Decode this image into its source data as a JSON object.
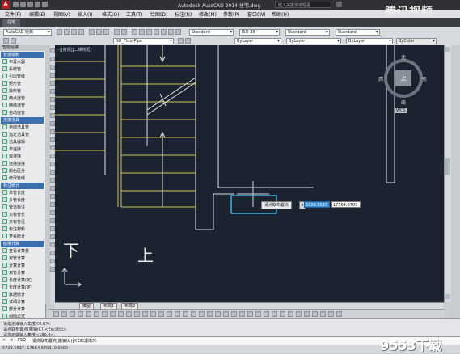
{
  "titlebar": {
    "app_letter": "A",
    "title": "Autodesk AutoCAD 2014    住宅.dwg",
    "search_placeholder": "键入关键字或短语"
  },
  "menubar": {
    "items": [
      "文件(F)",
      "编辑(E)",
      "视图(V)",
      "插入(I)",
      "格式(O)",
      "工具(T)",
      "绘图(D)",
      "标注(N)",
      "修改(M)",
      "参数(P)",
      "窗口(W)",
      "帮助(H)"
    ]
  },
  "tabstrip": {
    "tab_label": "住宅"
  },
  "toolbar1": {
    "workspace": "AutoCAD 经典",
    "textstyle": "Standard",
    "dimstyle": "ISO-25",
    "tablestyle": "Standard",
    "mleaderstyle": "Standard"
  },
  "toolbar2": {
    "layer": "NH_FloorPipe",
    "color": "ByLayer",
    "linetype": "ByLayer",
    "lineweight": "ByLayer",
    "plotstyle": "ByColor"
  },
  "palette": {
    "title": "智能给排",
    "sections": [
      {
        "header": "管道绘制",
        "items": [
          "布置水器",
          "系统管",
          "引出管线",
          "矩形管",
          "异形管",
          "两点连管",
          "两线连管",
          "自动连管"
        ]
      },
      {
        "header": "连接洁具",
        "items": [
          "自动洁具管",
          "指定洁具管",
          "洁具编辑",
          "单连接",
          "双连接",
          "连接连接",
          "颜色区分",
          "修改管线"
        ]
      },
      {
        "header": "标注统计",
        "items": [
          "单管长度",
          "多管长度",
          "管道标注",
          "只标管长",
          "只标管径",
          "标注材料",
          "查看统计"
        ]
      },
      {
        "header": "给排计算",
        "items": [
          "查看计算量",
          "双管计算",
          "计算计算",
          "双管计算",
          "长度计算(定)",
          "长度计算(定)",
          "数据统计",
          "详细计算",
          "部分计算",
          "间隔公式",
          "合计公式"
        ]
      }
    ]
  },
  "canvas": {
    "viewport_label": "[-][俯视][二维线框]",
    "viewcube": {
      "top_face": "上",
      "north": "北",
      "south": "南",
      "east": "东",
      "west": "西",
      "wcs": "WCS"
    },
    "down_label": "下",
    "up_label": "上",
    "tooltip": {
      "prompt": "请点取布置点",
      "x_value": "5729.5537",
      "y_value": "17564.6703"
    }
  },
  "model_tabs": [
    "模型",
    "布局1",
    "布局2"
  ],
  "command_history": [
    "请指定或输入角度<0.0>:",
    "请点取布置点[撤销(C)]<Esc退出>:",
    "请指定或输入角度<180.0>:"
  ],
  "command_line": {
    "prefix": "FSQ",
    "prompt": "请点取布置点[撤销(C)]<Esc退出>:"
  },
  "statusbar": {
    "coords": "5729.5537, 17564.6703, 0.0000"
  },
  "watermarks": {
    "top_right": "腾讯视频",
    "bottom_right": "9553下载"
  },
  "colors": {
    "canvas_bg": "#1c2330",
    "wall_lines": "#e0e0e0",
    "stair_lines": "#d8c85a",
    "cursor_box": "#3fb2d9",
    "palette_header": "#3c6fb0"
  }
}
